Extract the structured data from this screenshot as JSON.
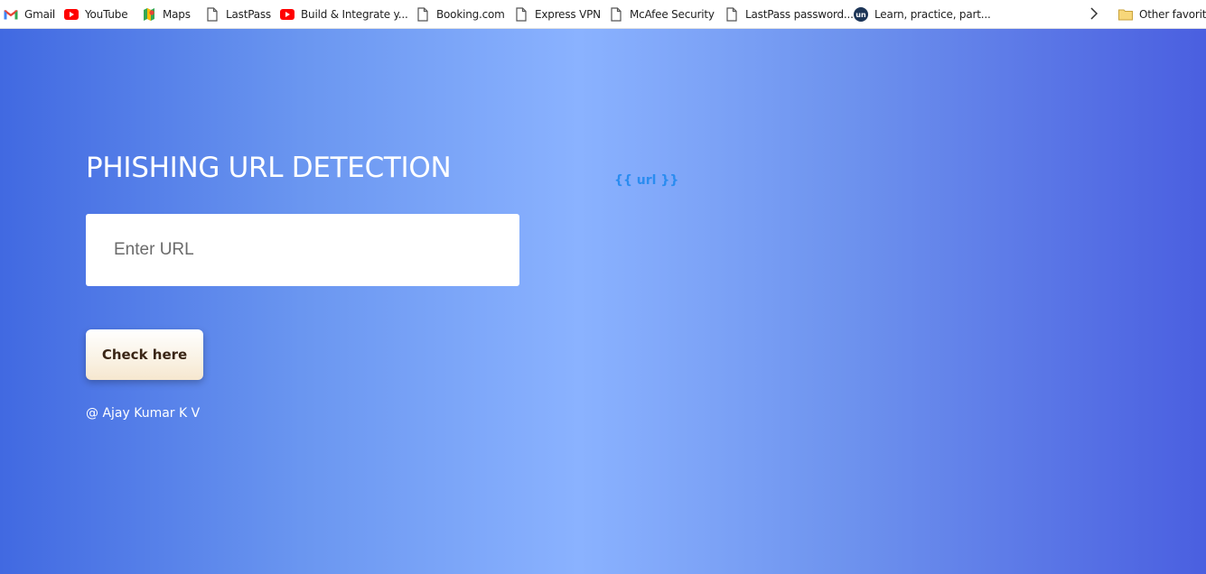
{
  "bookmarks": [
    {
      "label": "Gmail",
      "icon": "gmail-icon"
    },
    {
      "label": "YouTube",
      "icon": "youtube-icon"
    },
    {
      "label": "Maps",
      "icon": "maps-icon"
    },
    {
      "label": "LastPass",
      "icon": "page-icon"
    },
    {
      "label": "Build & Integrate y...",
      "icon": "youtube-icon"
    },
    {
      "label": "Booking.com",
      "icon": "page-icon"
    },
    {
      "label": "Express VPN",
      "icon": "page-icon"
    },
    {
      "label": "McAfee Security",
      "icon": "page-icon"
    },
    {
      "label": "LastPass password...",
      "icon": "page-icon"
    },
    {
      "label": "Learn, practice, part...",
      "icon": "un-icon"
    }
  ],
  "bookmarks_overflow_icon": "chevron-right-icon",
  "other_favorites": {
    "label": "Other favorite",
    "icon": "folder-icon"
  },
  "page": {
    "title": "PHISHING URL DETECTION",
    "url_template_text": "{{ url }}",
    "url_input_placeholder": "Enter URL",
    "url_input_value": "",
    "check_button_label": "Check here",
    "credit": "@ Ajay Kumar K V"
  },
  "colors": {
    "gradient": [
      "#4169e1",
      "#6a96f0",
      "#8ab2ff",
      "#6e93ee",
      "#4a5fe0"
    ],
    "url_template_text": "#2a8cf0",
    "button_text": "#3a2616"
  }
}
